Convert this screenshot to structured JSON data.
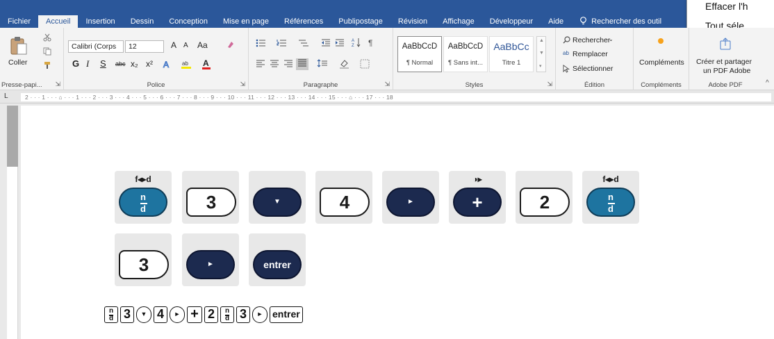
{
  "tabs": [
    "Fichier",
    "Accueil",
    "Insertion",
    "Dessin",
    "Conception",
    "Mise en page",
    "Références",
    "Publipostage",
    "Révision",
    "Affichage",
    "Développeur",
    "Aide"
  ],
  "active_tab": "Accueil",
  "tell_me": "Rechercher des outil",
  "context_menu": {
    "item1": "Effacer l'h",
    "item2": "Tout séle"
  },
  "ribbon": {
    "clipboard": {
      "paste": "Coller",
      "label": "Presse-papi..."
    },
    "font": {
      "name": "Calibri (Corps",
      "size": "12",
      "grow": "A",
      "shrink": "A",
      "case": "Aa",
      "label": "Police",
      "bold": "G",
      "italic": "I",
      "underline": "S",
      "strike": "abc",
      "sub": "x₂",
      "sup": "x²",
      "color_a": "A"
    },
    "paragraph": {
      "label": "Paragraphe"
    },
    "styles": {
      "label": "Styles",
      "items": [
        {
          "sample": "AaBbCcD",
          "name": "¶ Normal"
        },
        {
          "sample": "AaBbCcD",
          "name": "¶ Sans int..."
        },
        {
          "sample": "AaBbCc",
          "name": "Titre 1"
        }
      ]
    },
    "editing": {
      "label": "Édition",
      "find": "Rechercher",
      "replace": "Remplacer",
      "select": "Sélectionner"
    },
    "addins": {
      "button": "Compléments",
      "label": "Compléments"
    },
    "adobe": {
      "line1": "Créer et partager",
      "line2": "un PDF Adobe",
      "label": "Adobe PDF"
    }
  },
  "ruler": {
    "marks": "2 · · · 1 · · · ⌂ · · · 1 · · · 2 · · · 3 · · · 4 · · · 5 · · · 6 · · · 7 · · · 8 · · · 9 · · · 10 · · · 11 · · · 12 · · · 13 · · · 14 · · · 15 · · · ⌂ · · · 17 · · · 18"
  },
  "calc": {
    "frac_label": "f◂▸d",
    "contrast_label": "◑▸",
    "frac_n": "n",
    "frac_d": "d",
    "num1": "3",
    "num2": "4",
    "num3": "2",
    "num4": "3",
    "down_glyph": "▼",
    "right_glyph": "►",
    "plus": "+",
    "enter": "entrer"
  },
  "sequence": {
    "n": "n",
    "d": "d",
    "k3": "3",
    "k4": "4",
    "k2": "2",
    "k3b": "3",
    "down": "▼",
    "right": "►",
    "plus": "+",
    "enter": "entrer"
  }
}
